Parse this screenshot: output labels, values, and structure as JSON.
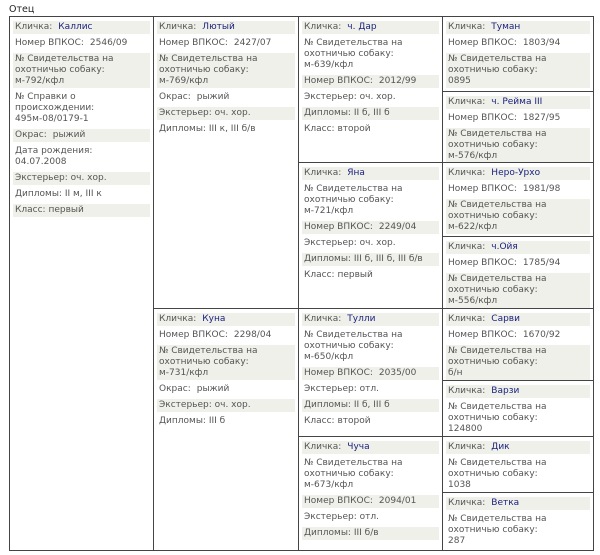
{
  "header": "Отец",
  "labels": {
    "nick": "Кличка:",
    "vpkos": "Номер ВПКОС:",
    "cert": "№ Свидетельства на охотничью собаку:",
    "origin": "№ Справки о происхождении:",
    "color": "Окрас:",
    "dob": "Дата рождения:",
    "ext": "Экстерьер:",
    "dipl": "Дипломы:",
    "class": "Класс:"
  },
  "dogs": [
    {
      "nick": "Каллис",
      "vpkos": "2546/09",
      "cert": "м-792/кфл",
      "origin": "495м-08/0179-1",
      "color": "рыжий",
      "dob": "04.07.2008",
      "ext": "оч. хор.",
      "dipl": "II м, III к",
      "class": "первый"
    },
    {
      "nick": "Лютый",
      "vpkos": "2427/07",
      "cert": "м-769/кфл",
      "color": "рыжий",
      "ext": "оч. хор.",
      "dipl": "III к, III б/в"
    },
    {
      "nick": "ч. Дар",
      "cert": "м-639/кфл",
      "vpkos": "2012/99",
      "ext": "оч. хор.",
      "dipl": "II б, III б",
      "class": "второй"
    },
    {
      "nick": "Туман",
      "vpkos": "1803/94",
      "cert": "0895"
    },
    {
      "nick": "ч. Рейма III",
      "vpkos": "1827/95",
      "cert": "м-576/кфл"
    },
    {
      "nick": "Яна",
      "cert": "м-721/кфл",
      "vpkos": "2249/04",
      "ext": "оч. хор.",
      "dipl": "III б, III б, III б/в",
      "class": "первый"
    },
    {
      "nick": "Неро-Урхо",
      "vpkos": "1981/98",
      "cert": "м-622/кфл"
    },
    {
      "nick": "ч.Ойя",
      "vpkos": "1785/94",
      "cert": "м-556/кфл"
    },
    {
      "nick": "Куна",
      "vpkos": "2298/04",
      "cert": "м-731/кфл",
      "color": "рыжий",
      "ext": "оч. хор.",
      "dipl": "III б"
    },
    {
      "nick": "Тулли",
      "cert": "м-650/кфл",
      "vpkos": "2035/00",
      "ext": "отл.",
      "dipl": "II б, III б",
      "class": "второй"
    },
    {
      "nick": "Сарви",
      "vpkos": "1670/92",
      "cert": "б/н"
    },
    {
      "nick": "Варзи",
      "cert": "124800"
    },
    {
      "nick": "Чуча",
      "cert": "м-673/кфл",
      "vpkos": "2094/01",
      "ext": "отл.",
      "dipl": "III б/в"
    },
    {
      "nick": "Дик",
      "cert": "1038"
    },
    {
      "nick": "Ветка",
      "cert": "287"
    }
  ]
}
